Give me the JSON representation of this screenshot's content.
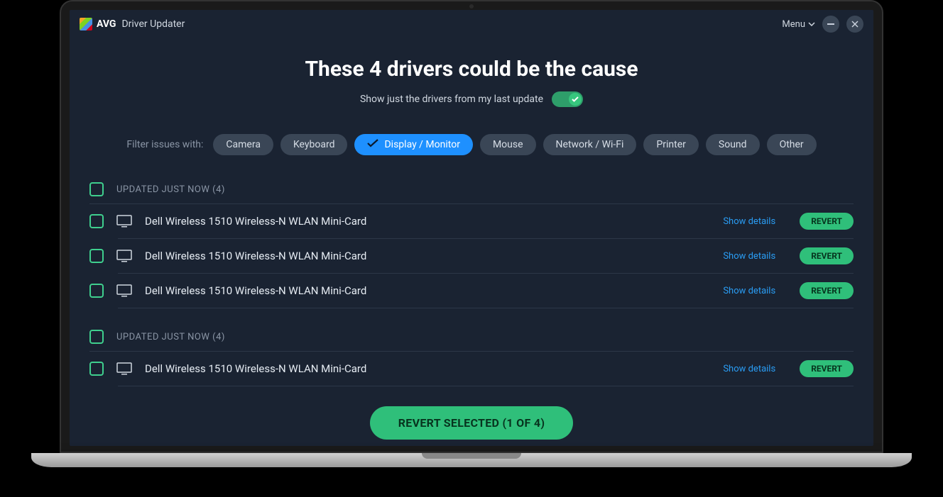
{
  "titlebar": {
    "brand": "AVG",
    "app_name": "Driver Updater",
    "menu_label": "Menu"
  },
  "headline": "These 4 drivers could be the cause",
  "subtoggle": {
    "label": "Show just the drivers from my last update",
    "on": true
  },
  "filters": {
    "label": "Filter issues with:",
    "items": [
      {
        "label": "Camera",
        "active": false
      },
      {
        "label": "Keyboard",
        "active": false
      },
      {
        "label": "Display / Monitor",
        "active": true
      },
      {
        "label": "Mouse",
        "active": false
      },
      {
        "label": "Network / Wi-Fi",
        "active": false
      },
      {
        "label": "Printer",
        "active": false
      },
      {
        "label": "Sound",
        "active": false
      },
      {
        "label": "Other",
        "active": false
      }
    ]
  },
  "groups": [
    {
      "header": "UPDATED JUST NOW (4)",
      "rows": [
        {
          "name": "Dell Wireless 1510 Wireless-N WLAN Mini-Card",
          "details": "Show details",
          "action": "REVERT"
        },
        {
          "name": "Dell Wireless 1510 Wireless-N WLAN Mini-Card",
          "details": "Show details",
          "action": "REVERT"
        },
        {
          "name": "Dell Wireless 1510 Wireless-N WLAN Mini-Card",
          "details": "Show details",
          "action": "REVERT"
        }
      ]
    },
    {
      "header": "UPDATED JUST NOW (4)",
      "rows": [
        {
          "name": "Dell Wireless 1510 Wireless-N WLAN Mini-Card",
          "details": "Show details",
          "action": "REVERT"
        }
      ]
    }
  ],
  "cta": "REVERT SELECTED (1 OF 4)"
}
